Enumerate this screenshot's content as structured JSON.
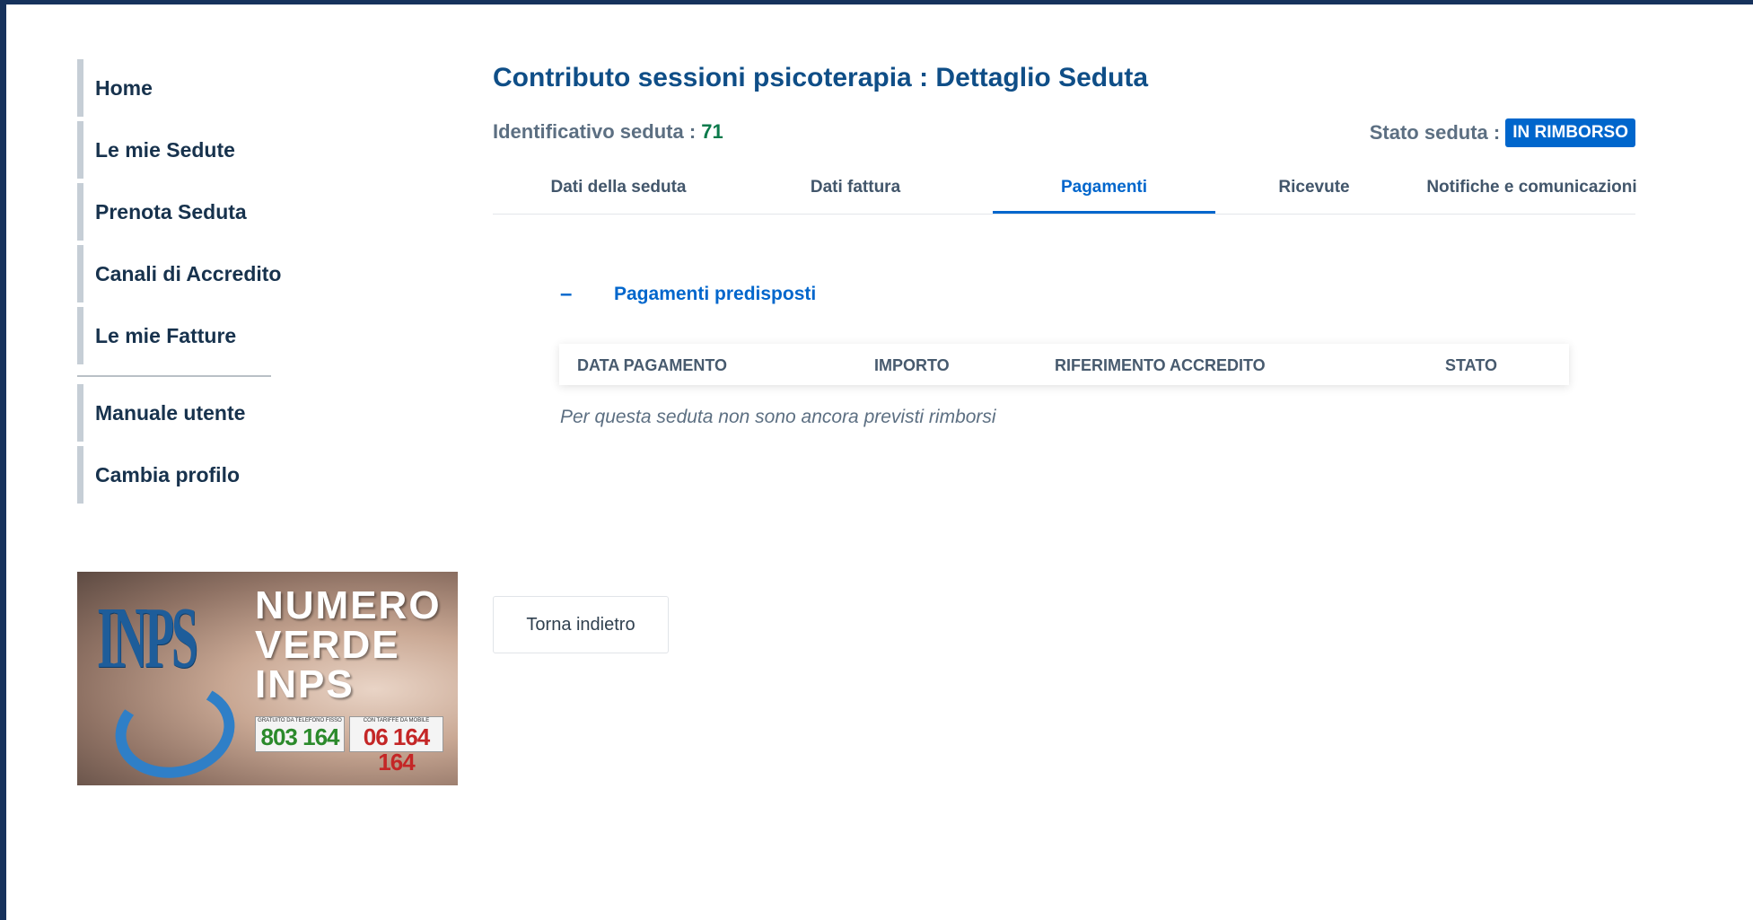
{
  "sidebar": {
    "items": [
      {
        "label": "Home"
      },
      {
        "label": "Le mie Sedute"
      },
      {
        "label": "Prenota Seduta"
      },
      {
        "label": "Canali di Accredito"
      },
      {
        "label": "Le mie Fatture"
      },
      {
        "label": "Manuale utente"
      },
      {
        "label": "Cambia profilo"
      }
    ]
  },
  "banner": {
    "logo_text": "INPS",
    "title_line1": "NUMERO",
    "title_line2": "VERDE",
    "title_line3": "INPS",
    "fixed_caption": "GRATUITO DA TELEFONO FISSO",
    "fixed_number": "803 164",
    "mobile_caption": "CON TARIFFE DA MOBILE",
    "mobile_number": "06 164 164"
  },
  "main": {
    "title": "Contributo sessioni psicoterapia : Dettaglio Seduta",
    "id_label": "Identificativo seduta : ",
    "id_value": "71",
    "stato_label": "Stato seduta :",
    "stato_value": "IN RIMBORSO",
    "tabs": [
      {
        "label": "Dati della seduta"
      },
      {
        "label": "Dati fattura"
      },
      {
        "label": "Pagamenti"
      },
      {
        "label": "Ricevute"
      },
      {
        "label": "Notifiche e comunicazioni"
      }
    ],
    "active_tab": "Pagamenti",
    "section": {
      "toggle_symbol": "–",
      "title": "Pagamenti predisposti"
    },
    "table": {
      "headers": [
        "DATA PAGAMENTO",
        "IMPORTO",
        "RIFERIMENTO ACCREDITO",
        "STATO"
      ]
    },
    "empty_message": "Per questa seduta non sono ancora previsti rimborsi",
    "back_button": "Torna indietro"
  },
  "colors": {
    "frame": "#16325c",
    "primary": "#0066cc",
    "nav_text": "#17324d",
    "id_value": "#0b7a4b"
  }
}
